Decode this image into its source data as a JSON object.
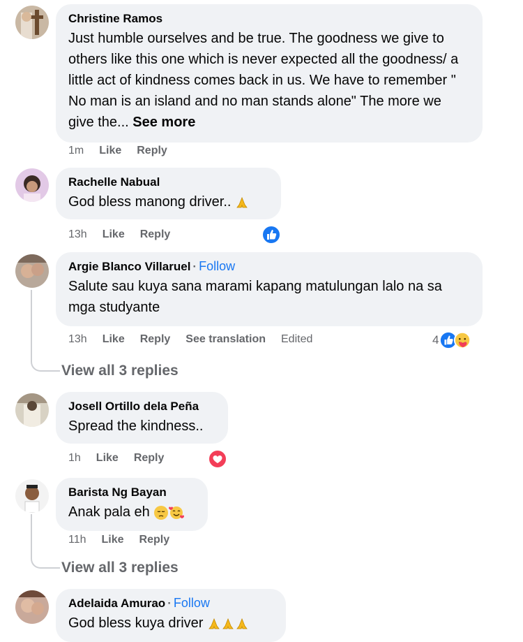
{
  "comments": [
    {
      "name": "Christine Ramos",
      "text": "Just humble ourselves and be true. The goodness we give to others like this one which is never expected all the goodness/ a little act of kindness comes back in us. We have to remember \" No man is an island and no man stands alone\" The more we give the...",
      "see_more": "See more",
      "time": "1m",
      "like": "Like",
      "reply": "Reply"
    },
    {
      "name": "Rachelle Nabual",
      "text": "God bless manong driver..",
      "time": "13h",
      "like": "Like",
      "reply": "Reply",
      "reactions": [
        "like-reaction-icon"
      ]
    },
    {
      "name": "Argie Blanco Villaruel",
      "follow": "Follow",
      "text": "Salute sau kuya sana marami kapang matulungan lalo na sa mga studyante",
      "time": "13h",
      "like": "Like",
      "reply": "Reply",
      "see_translation": "See translation",
      "edited": "Edited",
      "reaction_count": "4",
      "reactions": [
        "like-reaction-icon",
        "care-reaction-icon"
      ],
      "view_replies": "View all 3 replies"
    },
    {
      "name": "Josell Ortillo dela Peña",
      "text": "Spread the kindness..",
      "time": "1h",
      "like": "Like",
      "reply": "Reply",
      "reactions": [
        "love-reaction-icon"
      ]
    },
    {
      "name": "Barista Ng Bayan",
      "text": "Anak pala eh",
      "time": "11h",
      "like": "Like",
      "reply": "Reply",
      "view_replies": "View all 3 replies"
    },
    {
      "name": "Adelaida Amurao",
      "follow": "Follow",
      "text": "God bless kuya driver"
    }
  ],
  "colors": {
    "bubble": "#f0f2f5",
    "follow": "#1877f2",
    "meta": "#65676b",
    "like": "#1877f2",
    "love": "#f33e58"
  }
}
